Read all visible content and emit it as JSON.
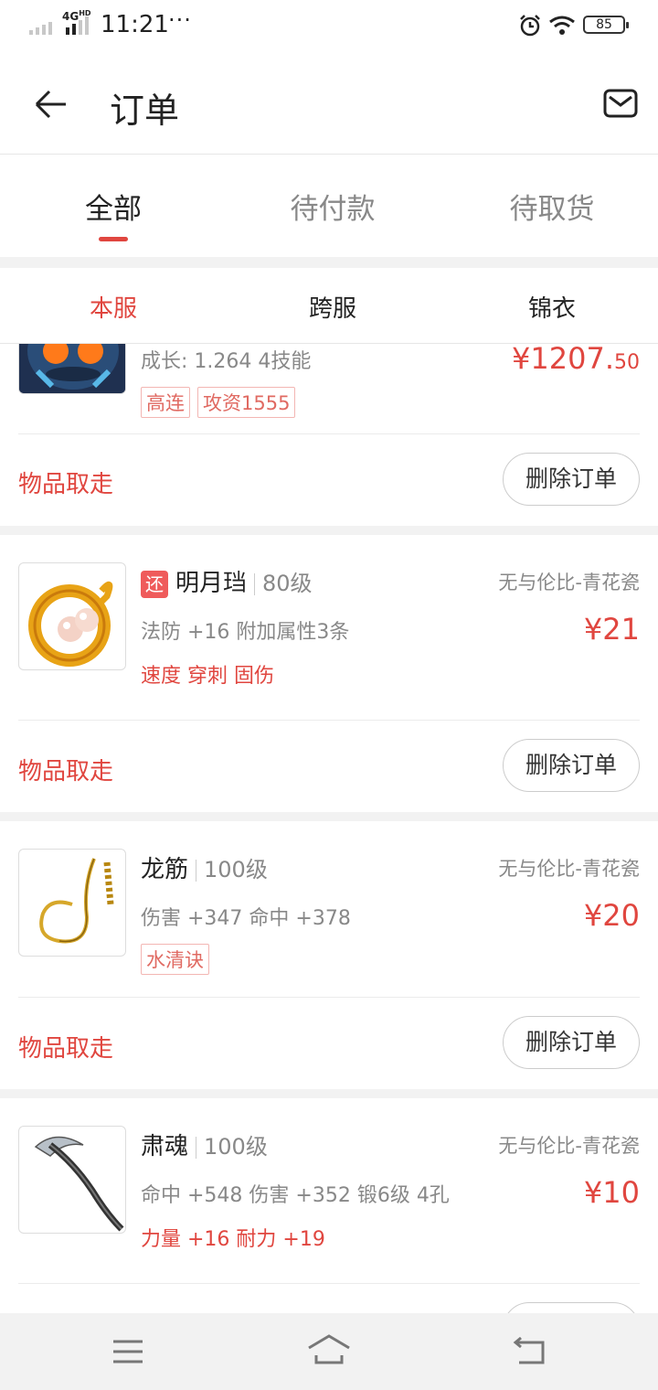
{
  "status_bar": {
    "network": "4G",
    "hd": "HD",
    "time": "11:21",
    "more": "···",
    "battery": "85"
  },
  "header": {
    "title": "订单"
  },
  "tabs": [
    {
      "label": "全部"
    },
    {
      "label": "待付款"
    },
    {
      "label": "待取货"
    }
  ],
  "subtabs": [
    {
      "label": "本服"
    },
    {
      "label": "跨服"
    },
    {
      "label": "锦衣"
    }
  ],
  "orders": [
    {
      "attrs": "成长: 1.264  4技能",
      "price_main": "¥1207.",
      "price_decimal": "50",
      "tags": [
        "高连",
        "攻资1555"
      ],
      "status": "物品取走",
      "action": "删除订单"
    },
    {
      "return_badge": "还",
      "name": "明月珰",
      "level": "80级",
      "server": "无与伦比-青花瓷",
      "attrs": "法防 +16  附加属性3条",
      "special": "速度 穿刺 固伤",
      "price": "¥21",
      "status": "物品取走",
      "action": "删除订单"
    },
    {
      "name": "龙筋",
      "level": "100级",
      "server": "无与伦比-青花瓷",
      "attrs": "伤害 +347 命中 +378",
      "tags": [
        "水清诀"
      ],
      "price": "¥20",
      "status": "物品取走",
      "action": "删除订单"
    },
    {
      "name": "肃魂",
      "level": "100级",
      "server": "无与伦比-青花瓷",
      "attrs": "命中 +548 伤害 +352  锻6级  4孔",
      "special": "力量 +16 耐力 +19",
      "price": "¥10"
    }
  ],
  "colors": {
    "accent": "#e0463f",
    "background": "#f2f2f2"
  }
}
